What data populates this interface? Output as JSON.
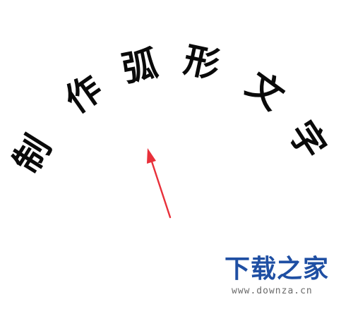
{
  "arc_text": {
    "characters": [
      "制",
      "作",
      "弧",
      "形",
      "文",
      "字"
    ],
    "color": "#0a0a0a"
  },
  "annotation_arrow": {
    "color": "#e8303a"
  },
  "watermark": {
    "title": "下载之家",
    "url": "www.downza.cn",
    "title_color": "#1f4fa3",
    "url_color": "#6b6b6b"
  }
}
